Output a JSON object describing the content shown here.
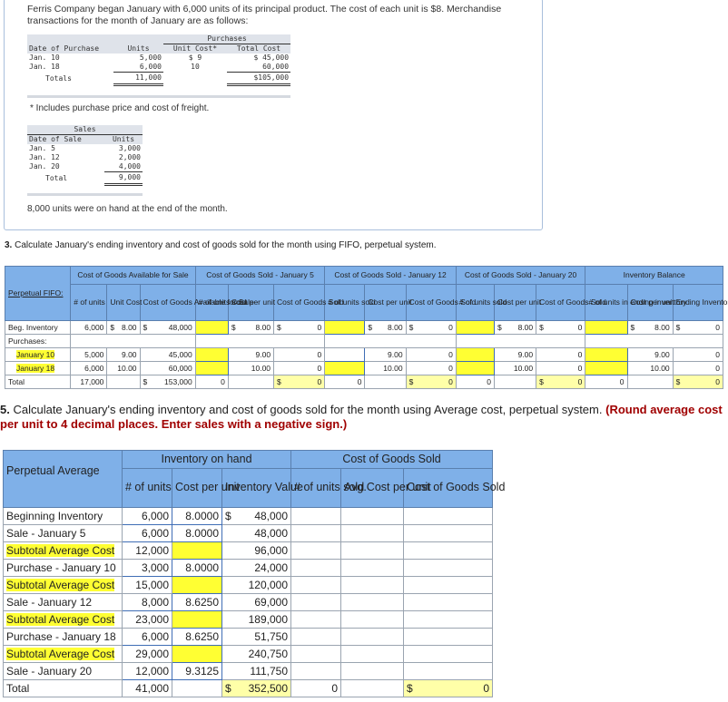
{
  "intro": "Ferris Company began January with 6,000 units of its principal product. The cost of each unit is $8. Merchandise transactions for the month of January are as follows:",
  "purchases": {
    "group": "Purchases",
    "headers": [
      "Date of Purchase",
      "Units",
      "Unit Cost*",
      "Total Cost"
    ],
    "rows": [
      [
        "Jan. 10",
        "5,000",
        "$ 9",
        "$ 45,000"
      ],
      [
        "Jan. 18",
        "6,000",
        "10",
        "60,000"
      ]
    ],
    "totals": [
      "Totals",
      "11,000",
      "",
      "$105,000"
    ]
  },
  "footnote": "* Includes purchase price and cost of freight.",
  "sales": {
    "group": "Sales",
    "headers": [
      "Date of Sale",
      "Units"
    ],
    "rows": [
      [
        "Jan. 5",
        "3,000"
      ],
      [
        "Jan. 12",
        "2,000"
      ],
      [
        "Jan. 20",
        "4,000"
      ]
    ],
    "total": [
      "Total",
      "9,000"
    ]
  },
  "on_hand": "8,000 units were on hand at the end of the month.",
  "q3": {
    "num": "3.",
    "text": "Calculate January's ending inventory and cost of goods sold for the month using FIFO, perpetual system."
  },
  "fifo": {
    "label": "Perpetual FIFO:",
    "groups": [
      "Cost of Goods Available for Sale",
      "Cost of Goods Sold - January 5",
      "Cost of Goods Sold - January 12",
      "Cost of Goods Sold - January 20",
      "Inventory Balance"
    ],
    "subheaders": [
      "# of units",
      "Unit Cost",
      "Cost of Goods Available for Sale",
      "# of units sold",
      "Cost per unit",
      "Cost of Goods Sold",
      "# of units sold",
      "Cost per unit",
      "Cost of Goods Sold",
      "# of units sold",
      "Cost per unit",
      "Cost of Goods Sold",
      "# of units in ending inventory",
      "Cost per unit",
      "Ending Inventory"
    ],
    "rows": {
      "beg": {
        "label": "Beg. Inventory",
        "units": "6,000",
        "cost": "8.00",
        "avail": "48,000",
        "cpu": "8.00",
        "cogs": "0",
        "ending": "0"
      },
      "purchases": "Purchases:",
      "jan10": {
        "label": "January 10",
        "units": "5,000",
        "cost": "9.00",
        "avail": "45,000",
        "cpu": "9.00",
        "cogs": "0",
        "ending": "0"
      },
      "jan18": {
        "label": "January 18",
        "units": "6,000",
        "cost": "10.00",
        "avail": "60,000",
        "cpu": "10.00",
        "cogs": "0",
        "ending": "0"
      },
      "total": {
        "label": "Total",
        "units": "17,000",
        "avail": "153,000",
        "sold": "0",
        "cogs": "0"
      }
    },
    "currency": "$"
  },
  "q5": {
    "num": "5.",
    "text": "Calculate January's ending inventory and cost of goods sold for the month using Average cost, perpetual system.",
    "instruction": "(Round average cost per unit to 4 decimal places. Enter sales with a negative sign.)"
  },
  "avg": {
    "label": "Perpetual Average",
    "groups": [
      "Inventory on hand",
      "Cost of Goods Sold"
    ],
    "subheaders": [
      "# of units",
      "Cost per unit",
      "Inventory Value",
      "# of units sold",
      "Avg.Cost per unit",
      "Cost of Goods Sold"
    ],
    "rows": [
      {
        "label": "Beginning Inventory",
        "units": "6,000",
        "cpu": "8.0000",
        "value": "48,000",
        "hl": false
      },
      {
        "label": "Sale - January 5",
        "units": "6,000",
        "cpu": "8.0000",
        "value": "48,000",
        "hl": false
      },
      {
        "label": "Subtotal Average Cost",
        "units": "12,000",
        "cpu": "",
        "value": "96,000",
        "hl": true
      },
      {
        "label": "Purchase - January 10",
        "units": "3,000",
        "cpu": "8.0000",
        "value": "24,000",
        "hl": false
      },
      {
        "label": "Subtotal Average Cost",
        "units": "15,000",
        "cpu": "",
        "value": "120,000",
        "hl": true
      },
      {
        "label": "Sale - January 12",
        "units": "8,000",
        "cpu": "8.6250",
        "value": "69,000",
        "hl": false
      },
      {
        "label": "Subtotal Average Cost",
        "units": "23,000",
        "cpu": "",
        "value": "189,000",
        "hl": true
      },
      {
        "label": "Purchase - January 18",
        "units": "6,000",
        "cpu": "8.6250",
        "value": "51,750",
        "hl": false
      },
      {
        "label": "Subtotal Average Cost",
        "units": "29,000",
        "cpu": "",
        "value": "240,750",
        "hl": true
      },
      {
        "label": "Sale - January 20",
        "units": "12,000",
        "cpu": "9.3125",
        "value": "111,750",
        "hl": false
      }
    ],
    "total": {
      "label": "Total",
      "units": "41,000",
      "value": "352,500",
      "sold": "0",
      "cogs": "0"
    },
    "currency": "$"
  },
  "colors": {
    "header_blue": "#7fb0e8",
    "highlight": "#ffff33",
    "total_fill": "#ffffa8",
    "instruction_red": "#a00000"
  }
}
